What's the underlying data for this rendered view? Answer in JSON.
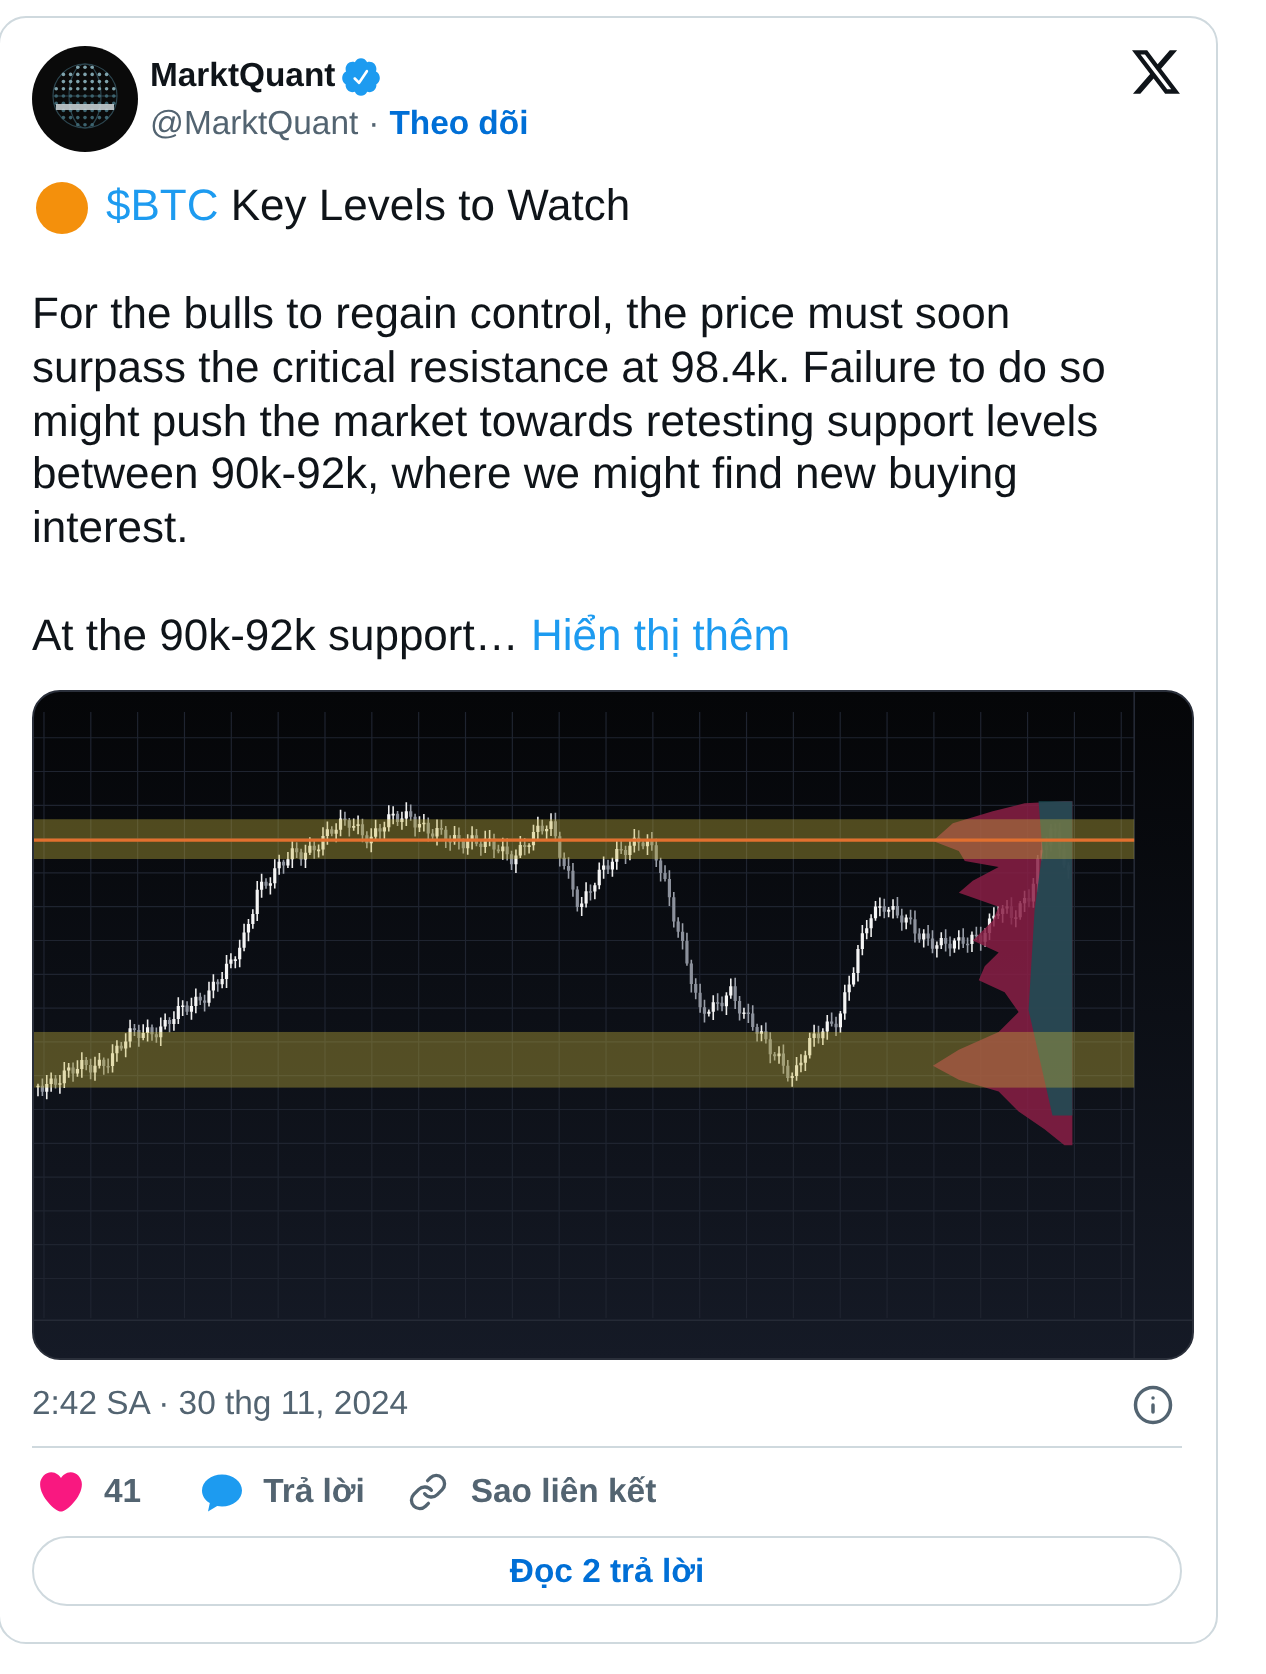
{
  "author": {
    "name": "MarktQuant",
    "verified": true,
    "handle": "@MarktQuant",
    "separator": "·",
    "follow_label": "Theo dõi"
  },
  "post": {
    "title": {
      "cashtag": "$BTC",
      "text": "Key Levels to Watch"
    },
    "paragraphs": [
      "For the bulls to regain control, the price must soon surpass the critical resistance at 98.4k. Failure to do so might push the market towards retesting support levels between 90k-92k, where we might find new buying interest."
    ],
    "truncated": {
      "text": "At the 90k-92k support…",
      "more_label": "Hiển thị thêm"
    }
  },
  "timestamp": "2:42 SA · 30 thg 11, 2024",
  "actions": [
    {
      "kind": "like",
      "label": "41"
    },
    {
      "kind": "reply",
      "label": "Trả lời"
    },
    {
      "kind": "copy_link",
      "label": "Sao liên kết"
    }
  ],
  "replies_button": "Đọc 2 trả lời"
}
